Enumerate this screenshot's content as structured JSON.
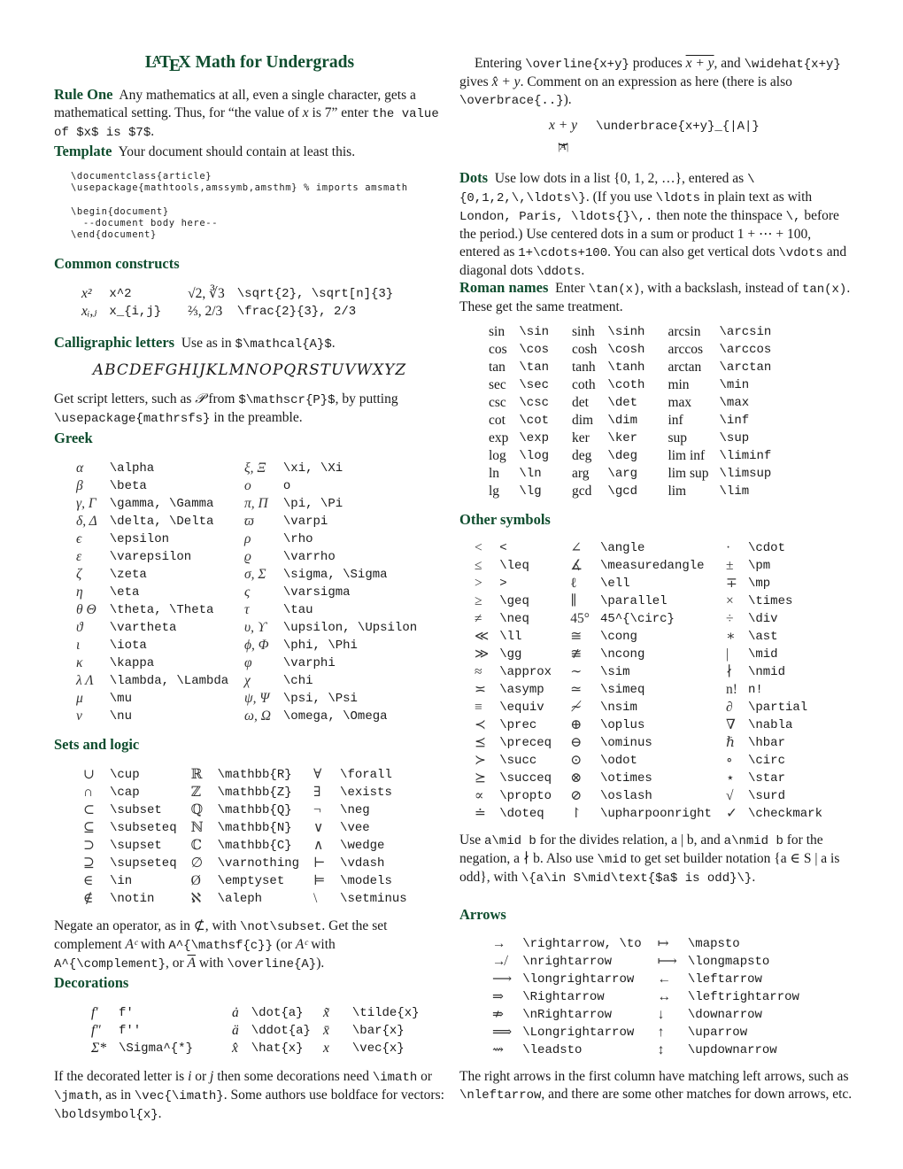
{
  "title": {
    "la": "L",
    "a": "A",
    "t": "T",
    "e": "E",
    "x": "X",
    "rest": " Math for Undergrads"
  },
  "rule_one": {
    "heading": "Rule One",
    "text1": "Any mathematics at all, even a single character, gets a mathematical setting. Thus, for “the value of ",
    "x": "x",
    "text2": " is 7” enter ",
    "code": "the value of $x$ is $7$",
    "text3": "."
  },
  "template": {
    "heading": "Template",
    "text": "Your document should contain at least this.",
    "code_lines": [
      "\\documentclass{article}",
      "\\usepackage{mathtools,amssymb,amsthm} % imports amsmath",
      "",
      "\\begin{document}",
      "  --document body here--",
      "\\end{document}"
    ]
  },
  "common": {
    "heading": "Common constructs",
    "rows": [
      {
        "s1": "x²",
        "c1": "x^2",
        "s2": "√2, ∛3",
        "c2": "\\sqrt{2}, \\sqrt[n]{3}"
      },
      {
        "s1": "xᵢ,ⱼ",
        "c1": "x_{i,j}",
        "s2": "⅔, 2/3",
        "c2": "\\frac{2}{3}, 2/3"
      }
    ]
  },
  "calligraphic": {
    "heading": "Calligraphic letters",
    "text1": "Use as in ",
    "code": "$\\mathcal{A}$",
    "text2": ".",
    "alphabet": "ABCDEFGHIJKLMNOPQRSTUVWXYZ",
    "script_text1": "Get script letters, such as ",
    "script_sym": "𝒫",
    "script_text2": " from ",
    "script_code": "$\\mathscr{P}$",
    "script_text3": ", by putting ",
    "script_code2": "\\usepackage{mathrsfs}",
    "script_text4": " in the preamble."
  },
  "greek": {
    "heading": "Greek",
    "left": [
      {
        "s": "α",
        "c": "\\alpha"
      },
      {
        "s": "β",
        "c": "\\beta"
      },
      {
        "s": "γ, Γ",
        "c": "\\gamma, \\Gamma"
      },
      {
        "s": "δ, Δ",
        "c": "\\delta, \\Delta"
      },
      {
        "s": "ϵ",
        "c": "\\epsilon"
      },
      {
        "s": "ε",
        "c": "\\varepsilon"
      },
      {
        "s": "ζ",
        "c": "\\zeta"
      },
      {
        "s": "η",
        "c": "\\eta"
      },
      {
        "s": "θ Θ",
        "c": "\\theta, \\Theta"
      },
      {
        "s": "ϑ",
        "c": "\\vartheta"
      },
      {
        "s": "ι",
        "c": "\\iota"
      },
      {
        "s": "κ",
        "c": "\\kappa"
      },
      {
        "s": "λ Λ",
        "c": "\\lambda, \\Lambda"
      },
      {
        "s": "μ",
        "c": "\\mu"
      },
      {
        "s": "ν",
        "c": "\\nu"
      }
    ],
    "right": [
      {
        "s": "ξ, Ξ",
        "c": "\\xi, \\Xi"
      },
      {
        "s": "o",
        "c": "o"
      },
      {
        "s": "π, Π",
        "c": "\\pi, \\Pi"
      },
      {
        "s": "ϖ",
        "c": "\\varpi"
      },
      {
        "s": "ρ",
        "c": "\\rho"
      },
      {
        "s": "ϱ",
        "c": "\\varrho"
      },
      {
        "s": "σ, Σ",
        "c": "\\sigma, \\Sigma"
      },
      {
        "s": "ς",
        "c": "\\varsigma"
      },
      {
        "s": "τ",
        "c": "\\tau"
      },
      {
        "s": "υ, ϒ",
        "c": "\\upsilon, \\Upsilon"
      },
      {
        "s": "ϕ, Φ",
        "c": "\\phi, \\Phi"
      },
      {
        "s": "φ",
        "c": "\\varphi"
      },
      {
        "s": "χ",
        "c": "\\chi"
      },
      {
        "s": "ψ, Ψ",
        "c": "\\psi, \\Psi"
      },
      {
        "s": "ω, Ω",
        "c": "\\omega, \\Omega"
      }
    ]
  },
  "sets": {
    "heading": "Sets and logic",
    "rows": [
      {
        "s1": "∪",
        "c1": "\\cup",
        "s2": "ℝ",
        "c2": "\\mathbb{R}",
        "s3": "∀",
        "c3": "\\forall"
      },
      {
        "s1": "∩",
        "c1": "\\cap",
        "s2": "ℤ",
        "c2": "\\mathbb{Z}",
        "s3": "∃",
        "c3": "\\exists"
      },
      {
        "s1": "⊂",
        "c1": "\\subset",
        "s2": "ℚ",
        "c2": "\\mathbb{Q}",
        "s3": "¬",
        "c3": "\\neg"
      },
      {
        "s1": "⊆",
        "c1": "\\subseteq",
        "s2": "ℕ",
        "c2": "\\mathbb{N}",
        "s3": "∨",
        "c3": "\\vee"
      },
      {
        "s1": "⊃",
        "c1": "\\supset",
        "s2": "ℂ",
        "c2": "\\mathbb{C}",
        "s3": "∧",
        "c3": "\\wedge"
      },
      {
        "s1": "⊇",
        "c1": "\\supseteq",
        "s2": "∅",
        "c2": "\\varnothing",
        "s3": "⊢",
        "c3": "\\vdash"
      },
      {
        "s1": "∈",
        "c1": "\\in",
        "s2": "Ø",
        "c2": "\\emptyset",
        "s3": "⊨",
        "c3": "\\models"
      },
      {
        "s1": "∉",
        "c1": "\\notin",
        "s2": "ℵ",
        "c2": "\\aleph",
        "s3": "\\",
        "c3": "\\setminus"
      }
    ],
    "neg_text1": "Negate an operator, as in ",
    "neg_sym": "⊄",
    "neg_text2": ", with ",
    "neg_code": "\\not\\subset",
    "neg_text3": ". Get the set complement ",
    "comp1": "Aᶜ",
    "neg_text4": " with ",
    "comp_code1": "A^{\\mathsf{c}}",
    "neg_text5": " (or ",
    "comp2": "Aᶜ",
    "neg_text6": " with ",
    "comp_code2": "A^{\\complement}",
    "neg_text7": ", or ",
    "comp3": "A",
    "neg_text8": " with ",
    "comp_code3": "\\overline{A}",
    "neg_text9": ")."
  },
  "decorations": {
    "heading": "Decorations",
    "rows": [
      {
        "s1": "f′",
        "c1": "f'",
        "s2": "ȧ",
        "c2": "\\dot{a}",
        "s3": "x̃",
        "c3": "\\tilde{x}"
      },
      {
        "s1": "f″",
        "c1": "f''",
        "s2": "ä",
        "c2": "\\ddot{a}",
        "s3": "x̄",
        "c3": "\\bar{x}"
      },
      {
        "s1": "Σ*",
        "c1": "\\Sigma^{*}",
        "s2": "x̂",
        "c2": "\\hat{x}",
        "s3": "x⃗",
        "c3": "\\vec{x}"
      }
    ],
    "text1": "If the decorated letter is ",
    "i": "i",
    "text2": " or ",
    "j": "j",
    "text3": " then some decorations need ",
    "code1": "\\imath",
    "text4": " or ",
    "code2": "\\jmath",
    "text5": ", as in ",
    "code3": "\\vec{\\imath}",
    "text6": ". Some authors use boldface for vectors: ",
    "code4": "\\boldsymbol{x}",
    "text7": "."
  },
  "overline": {
    "text1": "Entering ",
    "code1": "\\overline{x+y}",
    "text2": " produces ",
    "expr1": "x + y",
    "text3": ", and ",
    "code2": "\\widehat{x+y}",
    "text4": " gives ",
    "expr2": "x̂ + y",
    "text5": ". Comment on an expression as here (there is also ",
    "code3": "\\overbrace{..}",
    "text6": ").",
    "ub_expr": "x + y",
    "ub_brace": "⏟",
    "ub_sub": "|A|",
    "ub_code": "\\underbrace{x+y}_{|A|}"
  },
  "dots": {
    "heading": "Dots",
    "text": [
      {
        "t": "Use low dots in a list {0, 1, 2, …}, entered as "
      },
      {
        "c": "\\{0,1,2,\\,\\ldots\\}"
      },
      {
        "t": ". (If you use "
      },
      {
        "c": "\\ldots"
      },
      {
        "t": " in plain text as with "
      },
      {
        "c": "London, Paris, \\ldots{}\\,."
      },
      {
        "t": " then note the thinspace "
      },
      {
        "c": "\\,"
      },
      {
        "t": " before the period.) Use centered dots in a sum or product 1 + ⋯ + 100, entered as "
      },
      {
        "c": "1+\\cdots+100"
      },
      {
        "t": ". You can also get vertical dots "
      },
      {
        "c": "\\vdots"
      },
      {
        "t": " and diagonal dots "
      },
      {
        "c": "\\ddots"
      },
      {
        "t": "."
      }
    ]
  },
  "roman": {
    "heading": "Roman names",
    "text1": "Enter ",
    "code1": "\\tan(x)",
    "text2": ", with a backslash, instead of ",
    "code2": "tan(x)",
    "text3": ". These get the same treatment.",
    "rows": [
      {
        "s1": "sin",
        "c1": "\\sin",
        "s2": "sinh",
        "c2": "\\sinh",
        "s3": "arcsin",
        "c3": "\\arcsin"
      },
      {
        "s1": "cos",
        "c1": "\\cos",
        "s2": "cosh",
        "c2": "\\cosh",
        "s3": "arccos",
        "c3": "\\arccos"
      },
      {
        "s1": "tan",
        "c1": "\\tan",
        "s2": "tanh",
        "c2": "\\tanh",
        "s3": "arctan",
        "c3": "\\arctan"
      },
      {
        "s1": "sec",
        "c1": "\\sec",
        "s2": "coth",
        "c2": "\\coth",
        "s3": "min",
        "c3": "\\min"
      },
      {
        "s1": "csc",
        "c1": "\\csc",
        "s2": "det",
        "c2": "\\det",
        "s3": "max",
        "c3": "\\max"
      },
      {
        "s1": "cot",
        "c1": "\\cot",
        "s2": "dim",
        "c2": "\\dim",
        "s3": "inf",
        "c3": "\\inf"
      },
      {
        "s1": "exp",
        "c1": "\\exp",
        "s2": "ker",
        "c2": "\\ker",
        "s3": "sup",
        "c3": "\\sup"
      },
      {
        "s1": "log",
        "c1": "\\log",
        "s2": "deg",
        "c2": "\\deg",
        "s3": "lim inf",
        "c3": "\\liminf"
      },
      {
        "s1": "ln",
        "c1": "\\ln",
        "s2": "arg",
        "c2": "\\arg",
        "s3": "lim sup",
        "c3": "\\limsup"
      },
      {
        "s1": "lg",
        "c1": "\\lg",
        "s2": "gcd",
        "c2": "\\gcd",
        "s3": "lim",
        "c3": "\\lim"
      }
    ]
  },
  "other": {
    "heading": "Other symbols",
    "rows": [
      {
        "s1": "<",
        "c1": "<",
        "s2": "∠",
        "c2": "\\angle",
        "s3": "·",
        "c3": "\\cdot"
      },
      {
        "s1": "≤",
        "c1": "\\leq",
        "s2": "∡",
        "c2": "\\measuredangle",
        "s3": "±",
        "c3": "\\pm"
      },
      {
        "s1": ">",
        "c1": ">",
        "s2": "ℓ",
        "c2": "\\ell",
        "s3": "∓",
        "c3": "\\mp"
      },
      {
        "s1": "≥",
        "c1": "\\geq",
        "s2": "∥",
        "c2": "\\parallel",
        "s3": "×",
        "c3": "\\times"
      },
      {
        "s1": "≠",
        "c1": "\\neq",
        "s2": "45°",
        "c2": "45^{\\circ}",
        "s3": "÷",
        "c3": "\\div"
      },
      {
        "s1": "≪",
        "c1": "\\ll",
        "s2": "≅",
        "c2": "\\cong",
        "s3": "∗",
        "c3": "\\ast"
      },
      {
        "s1": "≫",
        "c1": "\\gg",
        "s2": "≇",
        "c2": "\\ncong",
        "s3": "|",
        "c3": "\\mid"
      },
      {
        "s1": "≈",
        "c1": "\\approx",
        "s2": "∼",
        "c2": "\\sim",
        "s3": "∤",
        "c3": "\\nmid"
      },
      {
        "s1": "≍",
        "c1": "\\asymp",
        "s2": "≃",
        "c2": "\\simeq",
        "s3": "n!",
        "c3": "n!"
      },
      {
        "s1": "≡",
        "c1": "\\equiv",
        "s2": "≁",
        "c2": "\\nsim",
        "s3": "∂",
        "c3": "\\partial"
      },
      {
        "s1": "≺",
        "c1": "\\prec",
        "s2": "⊕",
        "c2": "\\oplus",
        "s3": "∇",
        "c3": "\\nabla"
      },
      {
        "s1": "⪯",
        "c1": "\\preceq",
        "s2": "⊖",
        "c2": "\\ominus",
        "s3": "ℏ",
        "c3": "\\hbar"
      },
      {
        "s1": "≻",
        "c1": "\\succ",
        "s2": "⊙",
        "c2": "\\odot",
        "s3": "∘",
        "c3": "\\circ"
      },
      {
        "s1": "⪰",
        "c1": "\\succeq",
        "s2": "⊗",
        "c2": "\\otimes",
        "s3": "⋆",
        "c3": "\\star"
      },
      {
        "s1": "∝",
        "c1": "\\propto",
        "s2": "⊘",
        "c2": "\\oslash",
        "s3": "√",
        "c3": "\\surd"
      },
      {
        "s1": "≐",
        "c1": "\\doteq",
        "s2": "↾",
        "c2": "\\upharpoonright",
        "s3": "✓",
        "c3": "\\checkmark"
      }
    ],
    "mid_text": [
      {
        "t": "Use "
      },
      {
        "c": "a\\mid b"
      },
      {
        "t": " for the divides relation, a | b, and "
      },
      {
        "c": "a\\nmid b"
      },
      {
        "t": " for the negation, a ∤ b. Also use "
      },
      {
        "c": "\\mid"
      },
      {
        "t": " to get set builder notation {a ∈ S | a is odd}, with "
      },
      {
        "c": "\\{a\\in S\\mid\\text{$a$ is odd}\\}"
      },
      {
        "t": "."
      }
    ]
  },
  "arrows": {
    "heading": "Arrows",
    "rows": [
      {
        "s1": "→",
        "c1": "\\rightarrow, \\to",
        "s2": "↦",
        "c2": "\\mapsto"
      },
      {
        "s1": "↛",
        "c1": "\\nrightarrow",
        "s2": "⟼",
        "c2": "\\longmapsto"
      },
      {
        "s1": "⟶",
        "c1": "\\longrightarrow",
        "s2": "←",
        "c2": "\\leftarrow"
      },
      {
        "s1": "⇒",
        "c1": "\\Rightarrow",
        "s2": "↔",
        "c2": "\\leftrightarrow"
      },
      {
        "s1": "⇏",
        "c1": "\\nRightarrow",
        "s2": "↓",
        "c2": "\\downarrow"
      },
      {
        "s1": "⟹",
        "c1": "\\Longrightarrow",
        "s2": "↑",
        "c2": "\\uparrow"
      },
      {
        "s1": "⇝",
        "c1": "\\leadsto",
        "s2": "↕",
        "c2": "\\updownarrow"
      }
    ],
    "text1": "The right arrows in the first column have matching left arrows, such as ",
    "code": "\\nleftarrow",
    "text2": ", and there are some other matches for down arrows, etc."
  }
}
